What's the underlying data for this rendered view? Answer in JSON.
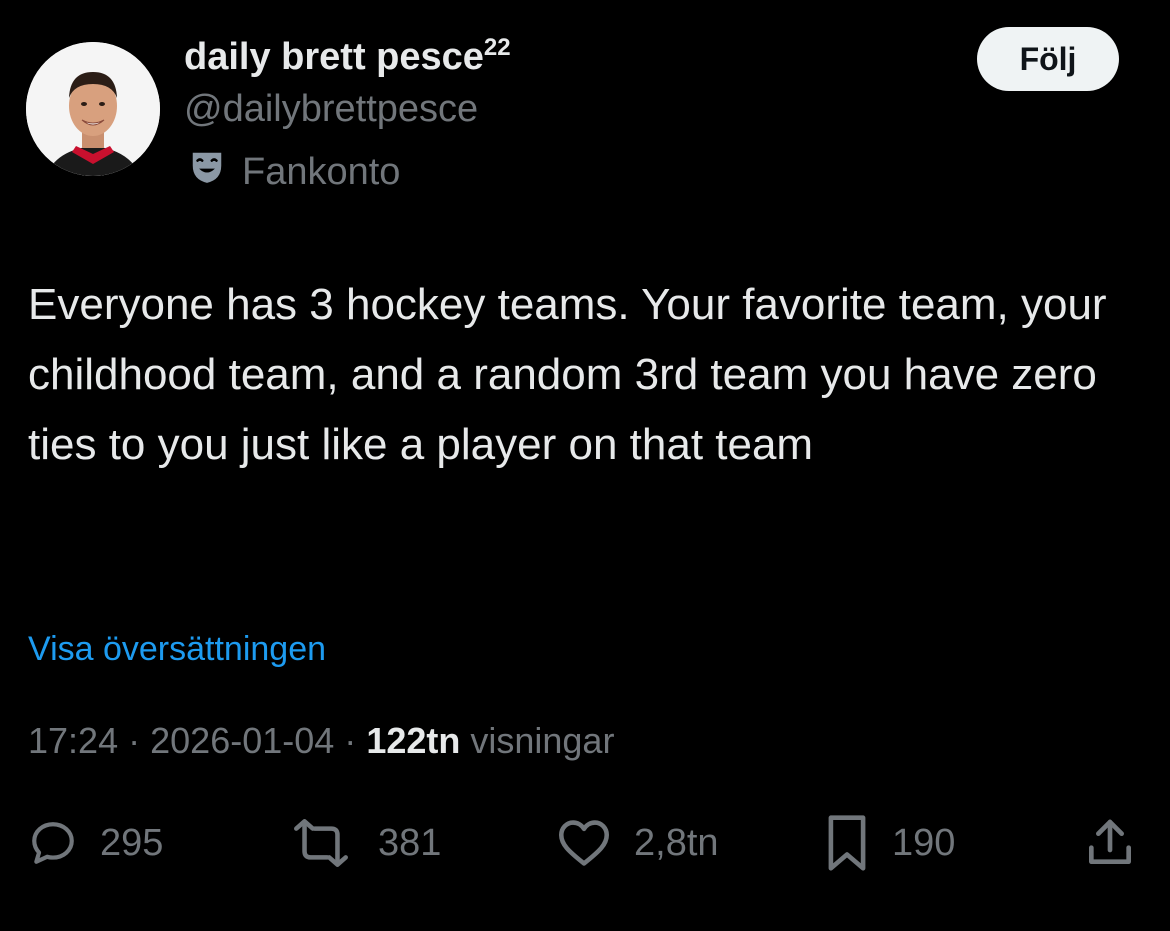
{
  "author": {
    "display_name": "daily brett pesce",
    "badge": "22",
    "handle": "@dailybrettpesce",
    "account_label": "Fankonto",
    "label_icon": "theater-mask-icon"
  },
  "follow_button": {
    "label": "Följ"
  },
  "tweet": {
    "text": "Everyone has 3 hockey teams. Your favorite team, your childhood team, and a random 3rd team you have zero ties to you just like a player on that team",
    "translate_link": "Visa översättningen"
  },
  "meta": {
    "time": "17:24",
    "separator": "·",
    "date": "2026-01-04",
    "views_count": "122tn",
    "views_label": "visningar"
  },
  "actions": {
    "replies": {
      "icon": "reply-icon",
      "count": "295"
    },
    "reposts": {
      "icon": "repost-icon",
      "count": "381"
    },
    "likes": {
      "icon": "heart-icon",
      "count": "2,8tn"
    },
    "bookmarks": {
      "icon": "bookmark-icon",
      "count": "190"
    },
    "share": {
      "icon": "share-icon"
    }
  },
  "colors": {
    "background": "#000000",
    "text_primary": "#e7e9ea",
    "text_secondary": "#71767b",
    "link": "#1d9bf0",
    "button_bg": "#eff3f4"
  }
}
